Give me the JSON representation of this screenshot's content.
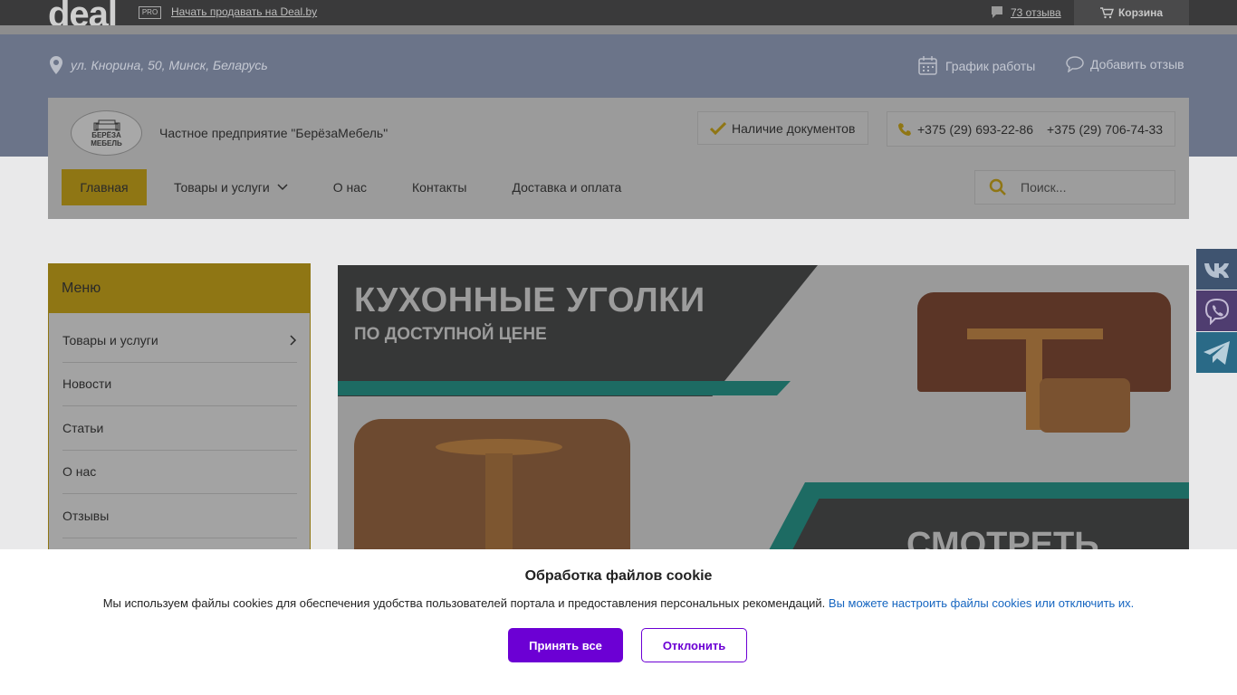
{
  "topbar": {
    "logo": "deal",
    "pro_badge": "PRO",
    "sell_link": "Начать продавать на Deal.by",
    "reviews_link": "73 отзыва",
    "cart_label": "Корзина"
  },
  "header": {
    "address": "ул. Кнорина, 50, Минск, Беларусь",
    "schedule_label": "График работы",
    "add_review_label": "Добавить отзыв"
  },
  "company": {
    "logo_line1": "БЕРЁЗА",
    "logo_line2": "МЕБЕЛЬ",
    "name": "Частное предприятие \"БерёзаМебель\"",
    "docs_label": "Наличие документов",
    "phone1": "+375 (29) 693-22-86",
    "phone2": "+375 (29) 706-74-33"
  },
  "nav": {
    "home": "Главная",
    "products": "Товары и услуги",
    "about": "О нас",
    "contacts": "Контакты",
    "delivery": "Доставка и оплата"
  },
  "search": {
    "placeholder": "Поиск..."
  },
  "sidebar": {
    "title": "Меню",
    "items": [
      {
        "label": "Товары и услуги"
      },
      {
        "label": "Новости"
      },
      {
        "label": "Статьи"
      },
      {
        "label": "О нас"
      },
      {
        "label": "Отзывы"
      }
    ]
  },
  "banner": {
    "headline": "КУХОННЫЕ УГОЛКИ",
    "subline": "ПО ДОСТУПНОЙ ЦЕНЕ",
    "cta": "СМОТРЕТЬ"
  },
  "cookie": {
    "title": "Обработка файлов cookie",
    "message": "Мы используем файлы cookies для обеспечения удобства пользователей портала и предоставления персональных рекомендаций.",
    "link": "Вы можете настроить файлы cookies или отключить их.",
    "accept": "Принять все",
    "decline": "Отклонить"
  },
  "colors": {
    "accent": "#6c00d4",
    "link": "#1565c0",
    "brand_yellow": "#f0c419"
  }
}
